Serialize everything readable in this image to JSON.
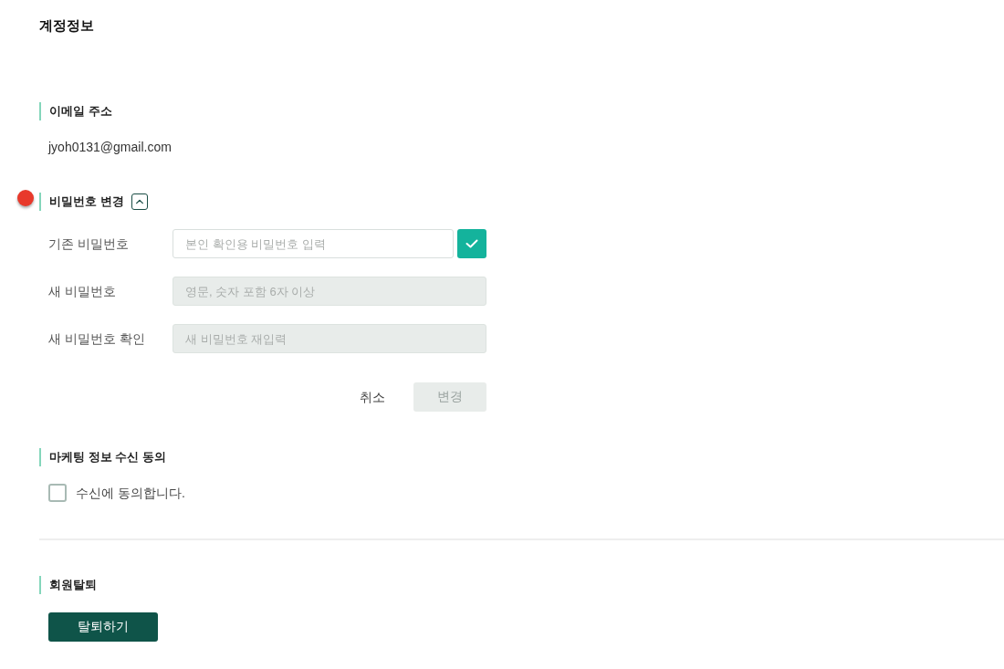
{
  "page": {
    "title": "계정정보"
  },
  "email_section": {
    "heading": "이메일 주소",
    "value": "jyoh0131@gmail.com"
  },
  "password_section": {
    "heading": "비밀번호 변경",
    "expanded": true,
    "fields": [
      {
        "label": "기존 비밀번호",
        "placeholder": "본인 확인용 비밀번호 입력",
        "disabled": false,
        "confirm_button": true
      },
      {
        "label": "새 비밀번호",
        "placeholder": "영문, 숫자 포함 6자 이상",
        "disabled": true,
        "confirm_button": false
      },
      {
        "label": "새 비밀번호 확인",
        "placeholder": "새 비밀번호 재입력",
        "disabled": true,
        "confirm_button": false
      }
    ],
    "cancel_button": "취소",
    "submit_button": {
      "label": "변경",
      "disabled": true
    }
  },
  "marketing_section": {
    "heading": "마케팅 정보 수신 동의",
    "checkbox": {
      "label": "수신에 동의합니다.",
      "checked": false
    }
  },
  "withdraw_section": {
    "heading": "회원탈퇴",
    "button": "탈퇴하기"
  }
}
